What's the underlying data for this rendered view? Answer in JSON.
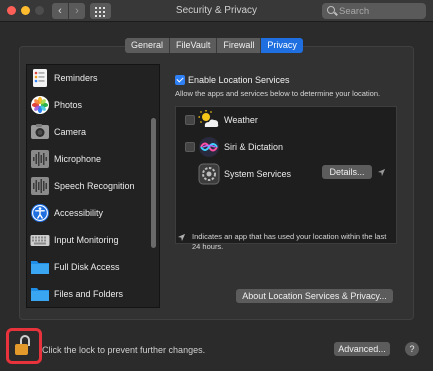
{
  "window": {
    "title": "Security & Privacy",
    "search_placeholder": "Search"
  },
  "tabs": [
    {
      "label": "General",
      "active": false
    },
    {
      "label": "FileVault",
      "active": false
    },
    {
      "label": "Firewall",
      "active": false
    },
    {
      "label": "Privacy",
      "active": true
    }
  ],
  "sidebar": {
    "items": [
      {
        "label": "Reminders",
        "icon": "reminders-icon"
      },
      {
        "label": "Photos",
        "icon": "photos-icon"
      },
      {
        "label": "Camera",
        "icon": "camera-icon"
      },
      {
        "label": "Microphone",
        "icon": "microphone-icon"
      },
      {
        "label": "Speech Recognition",
        "icon": "speech-recognition-icon"
      },
      {
        "label": "Accessibility",
        "icon": "accessibility-icon"
      },
      {
        "label": "Input Monitoring",
        "icon": "keyboard-icon"
      },
      {
        "label": "Full Disk Access",
        "icon": "folder-icon"
      },
      {
        "label": "Files and Folders",
        "icon": "folder-icon"
      }
    ]
  },
  "location": {
    "enable_label": "Enable Location Services",
    "enabled": true,
    "description": "Allow the apps and services below to determine your location.",
    "apps": [
      {
        "label": "Weather",
        "checked": false,
        "icon": "weather-icon"
      },
      {
        "label": "Siri & Dictation",
        "checked": false,
        "icon": "siri-icon"
      },
      {
        "label": "System Services",
        "icon": "system-services-icon",
        "details_label": "Details..."
      }
    ],
    "indicator_note": "Indicates an app that has used your location within the last 24 hours.",
    "about_button": "About Location Services & Privacy..."
  },
  "footer": {
    "lock_text": "Click the lock to prevent further changes.",
    "advanced_button": "Advanced...",
    "help_label": "?"
  },
  "colors": {
    "accent": "#1f6fe0",
    "highlight_box": "#e8333c"
  }
}
